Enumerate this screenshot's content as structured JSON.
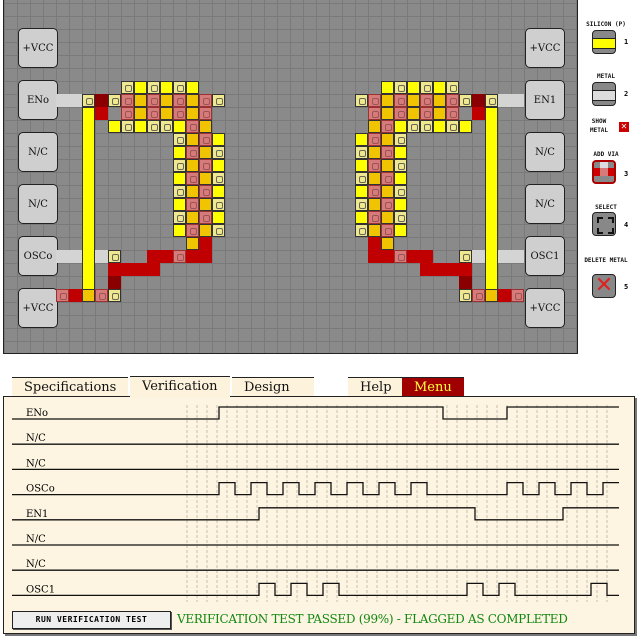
{
  "board": {
    "left_pads": [
      "+VCC",
      "ENo",
      "N/C",
      "N/C",
      "OSCo",
      "+VCC"
    ],
    "right_pads": [
      "+VCC",
      "EN1",
      "N/C",
      "N/C",
      "OSC1",
      "+VCC"
    ]
  },
  "tools": [
    {
      "label": "SILICON (P)",
      "key": "1",
      "icon": "silicon-icon"
    },
    {
      "label": "METAL",
      "key": "2",
      "icon": "metal-icon"
    },
    {
      "label": "SHOW METAL",
      "key": "",
      "icon": "show-metal-toggle",
      "checked": true
    },
    {
      "label": "ADD VIA",
      "key": "3",
      "icon": "add-via-icon",
      "selected": true
    },
    {
      "label": "SELECT",
      "key": "4",
      "icon": "select-icon"
    },
    {
      "label": "DELETE METAL",
      "key": "5",
      "icon": "delete-metal-icon"
    }
  ],
  "tabs": [
    {
      "label": "Specifications"
    },
    {
      "label": "Verification",
      "active": true
    },
    {
      "label": "Design Snippets"
    },
    {
      "label": "Help"
    },
    {
      "label": "Menu",
      "accent": "#a00000"
    }
  ],
  "verification": {
    "signals": [
      {
        "name": "ENo",
        "wave": [
          0,
          0,
          0,
          0,
          0,
          0,
          0,
          0,
          1,
          1,
          1,
          1,
          1,
          1,
          1,
          1,
          1,
          1,
          1,
          1,
          1,
          1,
          1,
          1,
          1,
          1,
          1,
          1,
          1,
          1,
          1,
          1,
          1,
          1,
          1,
          1,
          1,
          1,
          1,
          1,
          1,
          1,
          1,
          1,
          1,
          1,
          1,
          1,
          1,
          1,
          1,
          1,
          1,
          1,
          1,
          1,
          1,
          1,
          1,
          1,
          1,
          1,
          1,
          1,
          0,
          0,
          0,
          0,
          0,
          0,
          0,
          0,
          0,
          0,
          0,
          0,
          0,
          0,
          0,
          0,
          1,
          1,
          1,
          1,
          1,
          1,
          1,
          1,
          1,
          1,
          1,
          1,
          1,
          1,
          1,
          1,
          1,
          1,
          1,
          1,
          1,
          1,
          1,
          1,
          1,
          1,
          1,
          1,
          0,
          0,
          0,
          0,
          0,
          0,
          0,
          0,
          0,
          0
        ]
      },
      {
        "name": "N/C",
        "wave": []
      },
      {
        "name": "N/C",
        "wave": []
      },
      {
        "name": "OSCo",
        "wave": [
          0,
          0,
          0,
          0,
          0,
          0,
          0,
          0,
          1,
          1,
          1,
          1,
          0,
          0,
          0,
          0,
          1,
          1,
          1,
          1,
          0,
          0,
          0,
          0,
          1,
          1,
          1,
          1,
          0,
          0,
          0,
          0,
          1,
          1,
          1,
          1,
          0,
          0,
          0,
          0,
          1,
          1,
          1,
          1,
          0,
          0,
          0,
          0,
          1,
          1,
          1,
          1,
          0,
          0,
          0,
          0,
          1,
          1,
          1,
          1,
          0,
          0,
          0,
          0,
          0,
          0,
          0,
          0,
          0,
          0,
          0,
          0,
          0,
          0,
          0,
          0,
          0,
          0,
          0,
          0,
          1,
          1,
          1,
          1,
          0,
          0,
          0,
          0,
          1,
          1,
          1,
          1,
          0,
          0,
          0,
          0,
          1,
          1,
          1,
          1,
          0,
          0,
          0,
          0,
          1,
          1,
          1,
          1,
          0,
          0,
          0,
          0,
          0,
          0,
          0,
          0,
          0,
          0
        ]
      },
      {
        "name": "EN1",
        "wave": [
          0,
          0,
          0,
          0,
          0,
          0,
          0,
          0,
          0,
          0,
          0,
          0,
          0,
          0,
          0,
          0,
          0,
          0,
          1,
          1,
          1,
          1,
          1,
          1,
          1,
          1,
          1,
          1,
          1,
          1,
          1,
          1,
          1,
          1,
          1,
          1,
          1,
          1,
          1,
          1,
          1,
          1,
          1,
          1,
          1,
          1,
          1,
          1,
          1,
          1,
          1,
          1,
          1,
          1,
          1,
          1,
          1,
          1,
          1,
          1,
          1,
          1,
          1,
          1,
          1,
          1,
          1,
          1,
          1,
          1,
          1,
          1,
          0,
          0,
          0,
          0,
          0,
          0,
          0,
          0,
          0,
          0,
          0,
          0,
          0,
          0,
          0,
          0,
          0,
          0,
          0,
          0,
          0,
          0,
          1,
          1,
          1,
          1,
          1,
          1,
          1,
          1,
          1,
          1,
          1,
          1,
          1,
          1,
          1,
          0,
          0,
          0,
          0,
          0,
          0,
          0,
          0,
          0
        ]
      },
      {
        "name": "N/C",
        "wave": []
      },
      {
        "name": "N/C",
        "wave": []
      },
      {
        "name": "OSC1",
        "wave": [
          0,
          0,
          0,
          0,
          0,
          0,
          0,
          0,
          0,
          0,
          0,
          0,
          0,
          0,
          0,
          0,
          0,
          0,
          1,
          1,
          1,
          1,
          0,
          0,
          0,
          0,
          1,
          1,
          1,
          1,
          0,
          0,
          0,
          0,
          1,
          1,
          1,
          1,
          0,
          0,
          0,
          0,
          0,
          0,
          0,
          0,
          0,
          0,
          0,
          0,
          0,
          0,
          0,
          0,
          0,
          0,
          0,
          0,
          0,
          0,
          0,
          0,
          0,
          0,
          0,
          0,
          0,
          0,
          0,
          0,
          1,
          1,
          1,
          1,
          0,
          0,
          0,
          0,
          1,
          1,
          1,
          1,
          0,
          0,
          0,
          0,
          0,
          0,
          0,
          0,
          0,
          0,
          0,
          0,
          0,
          0,
          0,
          0,
          0,
          0,
          0,
          1,
          1,
          1,
          1,
          0,
          0,
          0,
          0,
          1,
          1,
          1,
          1,
          0,
          0,
          0,
          0,
          0
        ]
      }
    ],
    "run_button": "RUN VERIFICATION TEST",
    "status": "VERIFICATION TEST PASSED (99%) - FLAGGED AS COMPLETED",
    "status_color": "#118811"
  }
}
